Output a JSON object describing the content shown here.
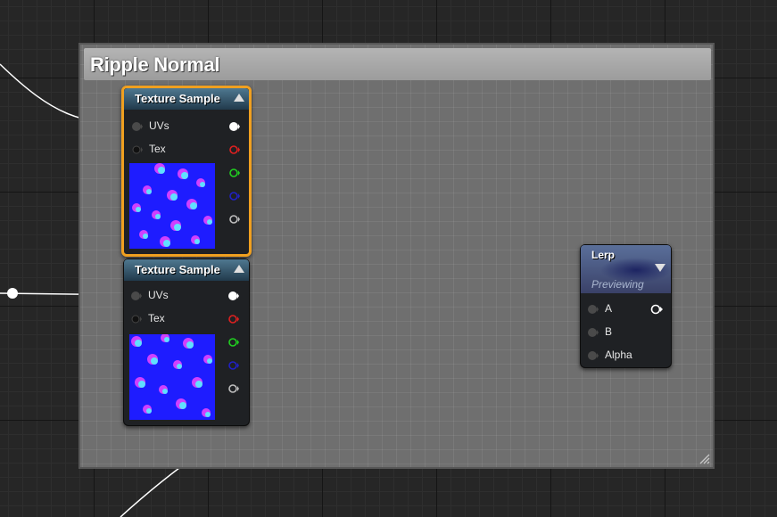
{
  "comment_box": {
    "title": "Ripple Normal"
  },
  "nodes": [
    {
      "title": "Texture Sample",
      "selected": true,
      "inputs": [
        {
          "label": "UVs"
        },
        {
          "label": "Tex"
        }
      ],
      "outputs": [
        {
          "channel": "rgb",
          "color": "#ffffff"
        },
        {
          "channel": "r",
          "color": "#e02020"
        },
        {
          "channel": "g",
          "color": "#20d020"
        },
        {
          "channel": "b",
          "color": "#2020c8"
        },
        {
          "channel": "a",
          "color": "#bfbfbf"
        }
      ]
    },
    {
      "title": "Texture Sample",
      "selected": false,
      "inputs": [
        {
          "label": "UVs"
        },
        {
          "label": "Tex"
        }
      ],
      "outputs": [
        {
          "channel": "rgb",
          "color": "#ffffff"
        },
        {
          "channel": "r",
          "color": "#e02020"
        },
        {
          "channel": "g",
          "color": "#20d020"
        },
        {
          "channel": "b",
          "color": "#2020c8"
        },
        {
          "channel": "a",
          "color": "#bfbfbf"
        }
      ]
    },
    {
      "title": "Lerp",
      "status": "Previewing",
      "inputs": [
        {
          "label": "A"
        },
        {
          "label": "B"
        },
        {
          "label": "Alpha"
        }
      ]
    }
  ],
  "colors": {
    "wire": "#ffffff",
    "selection": "#f0a020",
    "texture_preview": "#1e1cff"
  }
}
